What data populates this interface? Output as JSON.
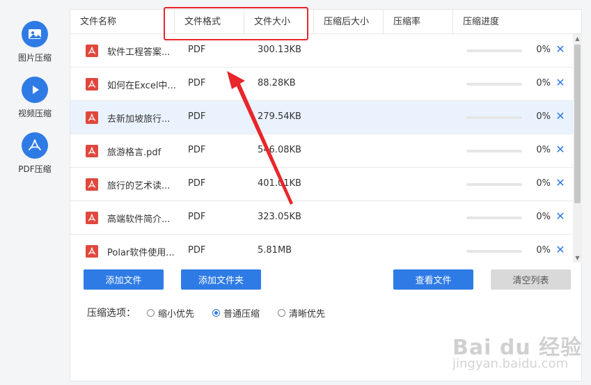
{
  "sidebar": {
    "items": [
      {
        "label": "图片压缩",
        "icon": "image-icon"
      },
      {
        "label": "视频压缩",
        "icon": "play-icon"
      },
      {
        "label": "PDF压缩",
        "icon": "pdf-icon"
      }
    ]
  },
  "table": {
    "columns": [
      "文件名称",
      "文件格式",
      "文件大小",
      "压缩后大小",
      "压缩率",
      "压缩进度"
    ],
    "rows": [
      {
        "name": "软件工程答案...",
        "format": "PDF",
        "size": "300.13KB",
        "progress": 0,
        "progress_label": "0%"
      },
      {
        "name": "如何在Excel中...",
        "format": "PDF",
        "size": "88.28KB",
        "progress": 0,
        "progress_label": "0%"
      },
      {
        "name": "去新加坡旅行...",
        "format": "PDF",
        "size": "279.54KB",
        "progress": 0,
        "progress_label": "0%"
      },
      {
        "name": "旅游格言.pdf",
        "format": "PDF",
        "size": "546.08KB",
        "progress": 0,
        "progress_label": "0%"
      },
      {
        "name": "旅行的艺术读...",
        "format": "PDF",
        "size": "401.01KB",
        "progress": 0,
        "progress_label": "0%"
      },
      {
        "name": "高端软件简介...",
        "format": "PDF",
        "size": "323.05KB",
        "progress": 0,
        "progress_label": "0%"
      },
      {
        "name": "Polar软件使用...",
        "format": "PDF",
        "size": "5.81MB",
        "progress": 0,
        "progress_label": "0%"
      }
    ],
    "remove_glyph": "✕"
  },
  "buttons": {
    "add_file": "添加文件",
    "add_folder": "添加文件夹",
    "view_files": "查看文件",
    "clear_list": "清空列表"
  },
  "options": {
    "label": "压缩选项：",
    "choices": [
      "缩小优先",
      "普通压缩",
      "清晰优先"
    ],
    "selected": "普通压缩"
  },
  "watermark": {
    "logo": "Bai du 经验",
    "url": "jingyan.baidu.com"
  },
  "colors": {
    "accent": "#2f7be6",
    "pdf_red": "#e0483d",
    "annotation_red": "#e8262b",
    "row_selected": "#eaf3fd"
  }
}
